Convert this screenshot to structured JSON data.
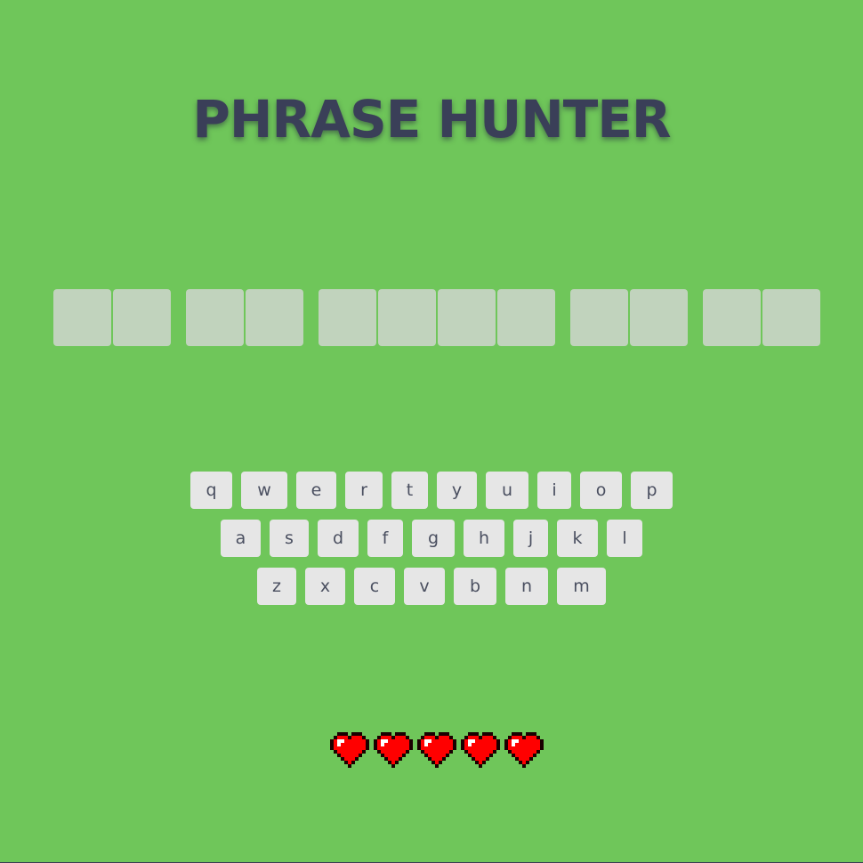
{
  "header": {
    "title": "PHRASE HUNTER"
  },
  "phrase": {
    "word_lengths": [
      2,
      2,
      4,
      2,
      2
    ],
    "revealed_letters": [],
    "tile_color": "#c1d3bd"
  },
  "keyboard": {
    "rows": [
      [
        "q",
        "w",
        "e",
        "r",
        "t",
        "y",
        "u",
        "i",
        "o",
        "p"
      ],
      [
        "a",
        "s",
        "d",
        "f",
        "g",
        "h",
        "j",
        "k",
        "l"
      ],
      [
        "z",
        "x",
        "c",
        "v",
        "b",
        "n",
        "m"
      ]
    ],
    "key_color": "#e6e6e6",
    "text_color": "#4a4f60"
  },
  "lives": {
    "remaining": 5,
    "total": 5,
    "icon": "pixel-heart-icon",
    "color": "#ff0000"
  },
  "colors": {
    "background": "#6fc65a",
    "title": "#3a3f58"
  }
}
